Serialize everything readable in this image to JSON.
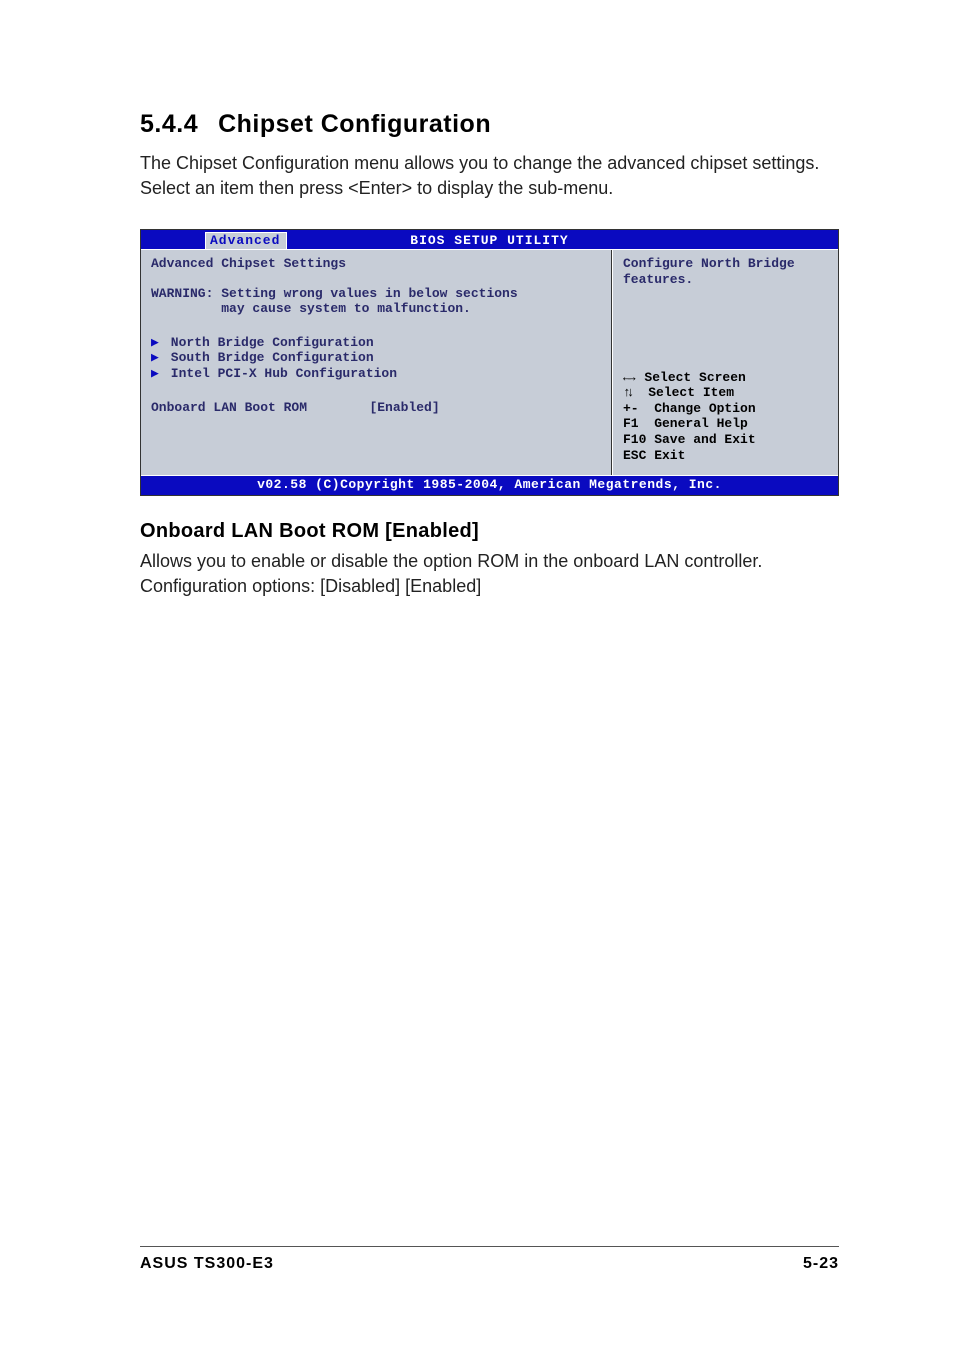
{
  "heading": {
    "number": "5.4.4",
    "title": "Chipset Configuration"
  },
  "intro": "The Chipset Configuration menu allows you to change the advanced chipset settings. Select an item then press <Enter> to display the sub-menu.",
  "bios": {
    "title": "BIOS SETUP UTILITY",
    "tab": "Advanced",
    "left_title": "Advanced Chipset Settings",
    "warning_line1": "WARNING: Setting wrong values in below sections",
    "warning_line2": "         may cause system to malfunction.",
    "menu": [
      "North Bridge Configuration",
      "South Bridge Configuration",
      "Intel PCI-X Hub Configuration"
    ],
    "setting": {
      "label": "Onboard LAN Boot ROM",
      "value": "[Enabled]"
    },
    "help": "Configure North Bridge features.",
    "keys": [
      {
        "k": "↔",
        "label": "Select Screen",
        "cls": "lr"
      },
      {
        "k": "↕",
        "label": "Select Item",
        "cls": "ud"
      },
      {
        "k": "+-",
        "label": "Change Option",
        "cls": "txt"
      },
      {
        "k": "F1",
        "label": "General Help",
        "cls": "txt"
      },
      {
        "k": "F10",
        "label": "Save and Exit",
        "cls": "txt"
      },
      {
        "k": "ESC",
        "label": "Exit",
        "cls": "txt"
      }
    ],
    "footer": "v02.58 (C)Copyright 1985-2004, American Megatrends, Inc."
  },
  "subheading": "Onboard LAN Boot ROM [Enabled]",
  "subbody": "Allows you to enable or disable the option ROM in the onboard LAN controller. Configuration options: [Disabled] [Enabled]",
  "footer": {
    "left": "ASUS TS300-E3",
    "right": "5-23"
  }
}
